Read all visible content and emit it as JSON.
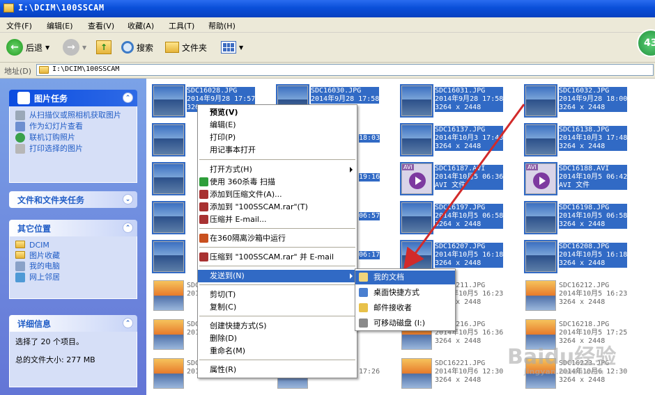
{
  "window": {
    "title": "I:\\DCIM\\100SSCAM"
  },
  "menubar": [
    "文件(F)",
    "编辑(E)",
    "查看(V)",
    "收藏(A)",
    "工具(T)",
    "帮助(H)"
  ],
  "toolbar": {
    "back": "后退",
    "search": "搜索",
    "folders": "文件夹"
  },
  "address": {
    "label": "地址(D)",
    "path": "I:\\DCIM\\100SSCAM"
  },
  "tasks": {
    "picture": {
      "title": "图片任务",
      "items": [
        "从扫描仪或照相机获取图片",
        "作为幻灯片查看",
        "联机订购照片",
        "打印选择的图片"
      ]
    },
    "filefolder": {
      "title": "文件和文件夹任务"
    },
    "other": {
      "title": "其它位置",
      "items": [
        "DCIM",
        "图片收藏",
        "我的电脑",
        "网上邻居"
      ]
    },
    "details": {
      "title": "详细信息",
      "selected": "选择了 20 个项目。",
      "size": "总的文件大小: 277 MB"
    }
  },
  "files": [
    {
      "name": "SDC16028.JPG",
      "date": "2014年9月28 17:57",
      "dims": "3264 x 2448",
      "sel": true,
      "kind": "jpg"
    },
    {
      "name": "SDC16030.JPG",
      "date": "2014年9月28 17:58",
      "dims": "",
      "sel": true,
      "kind": "jpg"
    },
    {
      "name": "SDC16031.JPG",
      "date": "2014年9月28 17:58",
      "dims": "3264 x 2448",
      "sel": true,
      "kind": "jpg"
    },
    {
      "name": "SDC16032.JPG",
      "date": "2014年9月28 18:00",
      "dims": "3264 x 2448",
      "sel": true,
      "kind": "jpg"
    },
    {
      "name": "SDC16137.JPG",
      "date": "2014年10月3 17:48",
      "dims": "3264 x 2448",
      "sel": true,
      "kind": "jpg"
    },
    {
      "name": "SDC16138.JPG",
      "date": "2014年10月3 17:48",
      "dims": "3264 x 2448",
      "sel": true,
      "kind": "jpg"
    },
    {
      "name": "SDC16187.AVI",
      "date": "2014年10月5 06:36",
      "dims": "AVI 文件",
      "sel": true,
      "kind": "avi"
    },
    {
      "name": "SDC16188.AVI",
      "date": "2014年10月5 06:42",
      "dims": "AVI 文件",
      "sel": true,
      "kind": "avi"
    },
    {
      "name": "SDC16197.JPG",
      "date": "2014年10月5 06:58",
      "dims": "3264 x 2448",
      "sel": true,
      "kind": "jpg"
    },
    {
      "name": "SDC16198.JPG",
      "date": "2014年10月5 06:58",
      "dims": "3264 x 2448",
      "sel": true,
      "kind": "jpg"
    },
    {
      "name": "SDC16207.JPG",
      "date": "2014年10月5 16:18",
      "dims": "3264 x 2448",
      "sel": true,
      "kind": "jpg"
    },
    {
      "name": "SDC16208.JPG",
      "date": "2014年10月5 16:18",
      "dims": "3264 x 2448",
      "sel": true,
      "kind": "jpg"
    },
    {
      "name": "SDC16211.JPG",
      "date": "2014年10月5 16:23",
      "dims": "3264 x 2448",
      "sel": false,
      "kind": "img"
    },
    {
      "name": "SDC16212.JPG",
      "date": "2014年10月5 16:23",
      "dims": "3264 x 2448",
      "sel": false,
      "kind": "img"
    },
    {
      "name": "SDC16216.JPG",
      "date": "2014年10月5 16:36",
      "dims": "3264 x 2448",
      "sel": false,
      "kind": "img"
    },
    {
      "name": "SDC16218.JPG",
      "date": "2014年10月5 17:25",
      "dims": "3264 x 2448",
      "sel": false,
      "kind": "img"
    },
    {
      "name": "SDC16221.JPG",
      "date": "2014年10月6 12:30",
      "dims": "3264 x 2448",
      "sel": false,
      "kind": "img"
    },
    {
      "name": "SDC16223.JPG",
      "date": "2014年10月6 12:30",
      "dims": "3264 x 2448",
      "sel": false,
      "kind": "img"
    }
  ],
  "partial_col1": [
    {
      "a": "SDC",
      "b": "201"
    },
    {
      "a": "SDC",
      "b": "201"
    },
    {
      "a": "SDC",
      "b": "201"
    },
    {
      "a": "SDC",
      "b": "201"
    },
    {
      "a": "SDC",
      "b": "201"
    },
    {
      "a": "SDC",
      "b": "201"
    },
    {
      "a": "SDC",
      "b": "201"
    },
    {
      "a": "SDC",
      "b": "201"
    }
  ],
  "context_menu": {
    "items": [
      "预览(V)",
      "编辑(E)",
      "打印(P)",
      "用记事本打开",
      "打开方式(H)",
      "使用 360杀毒 扫描",
      "添加到压缩文件(A)...",
      "添加到 \"100SSCAM.rar\"(T)",
      "压缩并 E-mail...",
      "在360隔离沙箱中运行",
      "压缩到 \"100SSCAM.rar\" 并 E-mail",
      "发送到(N)",
      "剪切(T)",
      "复制(C)",
      "创建快捷方式(S)",
      "删除(D)",
      "重命名(M)",
      "属性(R)"
    ]
  },
  "sendto_menu": {
    "items": [
      "我的文档",
      "桌面快捷方式",
      "邮件接收者",
      "可移动磁盘 (I:)"
    ]
  },
  "peek": {
    "times": [
      "18:03",
      "19:16",
      "06:57",
      "06:17",
      "17:26"
    ],
    "widths": [
      "2448",
      "2448"
    ]
  },
  "badge": "43",
  "watermark": {
    "brand": "Baidu经验",
    "url": "jingyan.baidu.com"
  },
  "colors": {
    "selection": "#316ac5",
    "titlebar": "#0a4fd9",
    "arrow": "#d22a2a"
  }
}
